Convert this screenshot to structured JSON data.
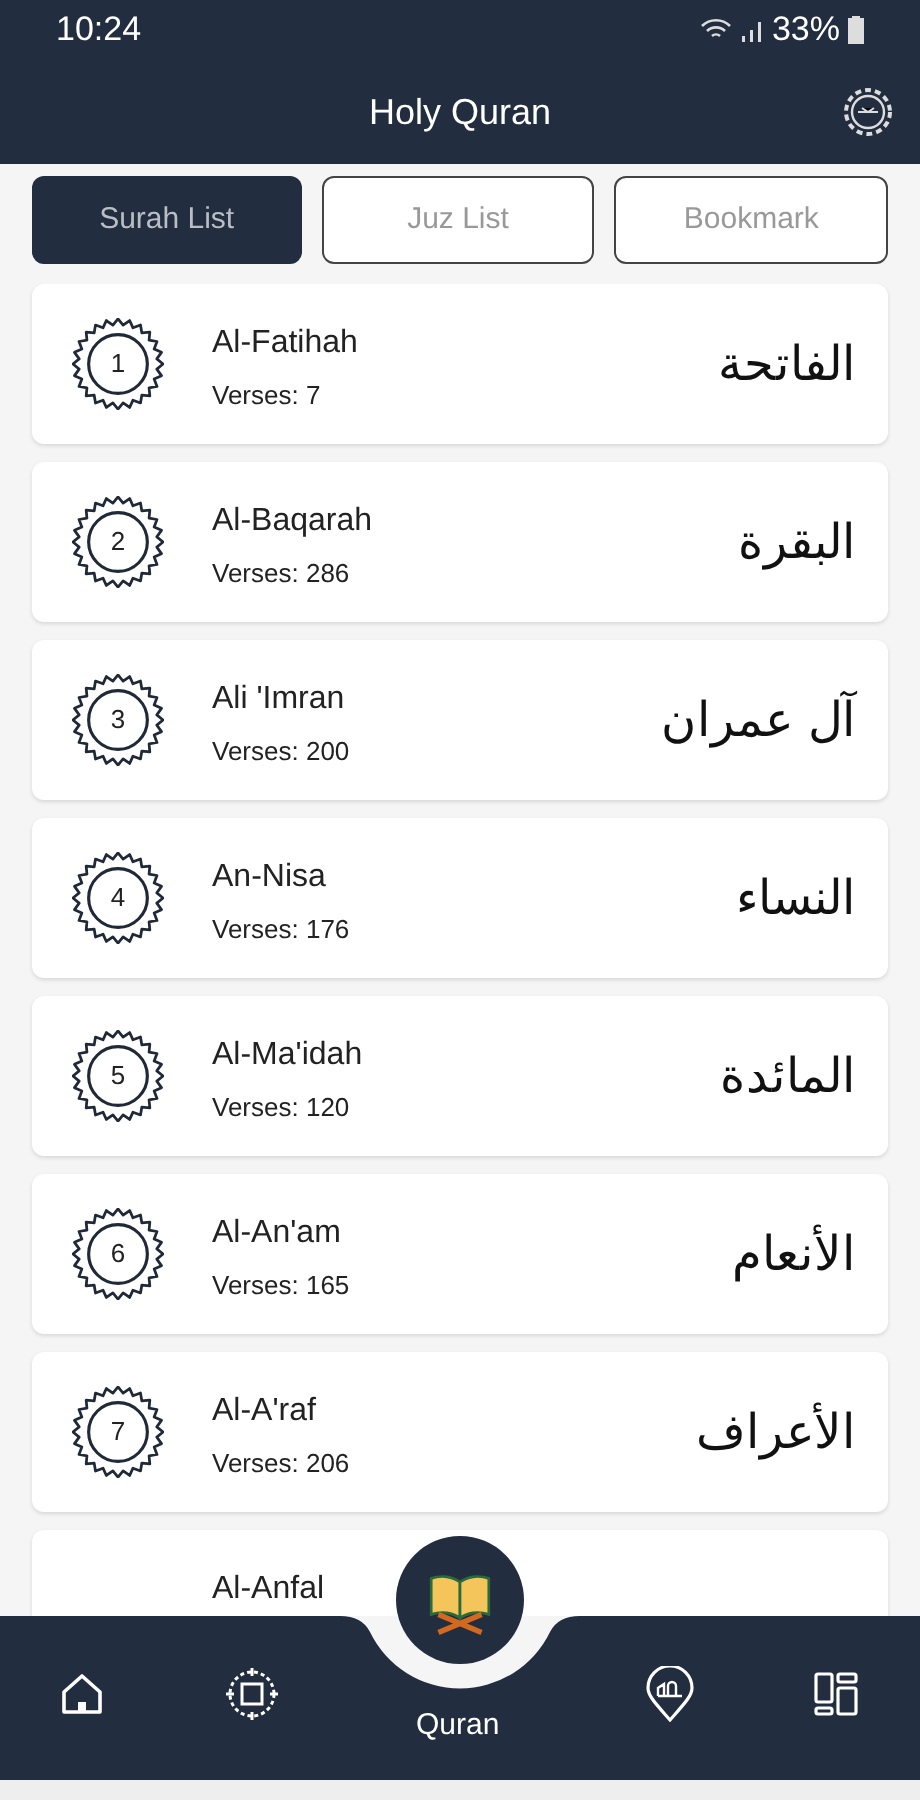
{
  "status_bar": {
    "time": "10:24",
    "battery": "33%"
  },
  "header": {
    "title": "Holy Quran"
  },
  "tabs": [
    {
      "label": "Surah List",
      "selected": true
    },
    {
      "label": "Juz List",
      "selected": false
    },
    {
      "label": "Bookmark",
      "selected": false
    }
  ],
  "surahs": [
    {
      "number": "1",
      "name": "Al-Fatihah",
      "verses": "Verses: 7",
      "arabic": "الفاتحة"
    },
    {
      "number": "2",
      "name": "Al-Baqarah",
      "verses": "Verses: 286",
      "arabic": "البقرة"
    },
    {
      "number": "3",
      "name": "Ali 'Imran",
      "verses": "Verses: 200",
      "arabic": "آل عمران"
    },
    {
      "number": "4",
      "name": "An-Nisa",
      "verses": "Verses: 176",
      "arabic": "النساء"
    },
    {
      "number": "5",
      "name": "Al-Ma'idah",
      "verses": "Verses: 120",
      "arabic": "المائدة"
    },
    {
      "number": "6",
      "name": "Al-An'am",
      "verses": "Verses: 165",
      "arabic": "الأنعام"
    },
    {
      "number": "7",
      "name": "Al-A'raf",
      "verses": "Verses: 206",
      "arabic": "الأعراف"
    },
    {
      "name": "Al-Anfal"
    }
  ],
  "bottom_nav": {
    "center_label": "Quran"
  }
}
